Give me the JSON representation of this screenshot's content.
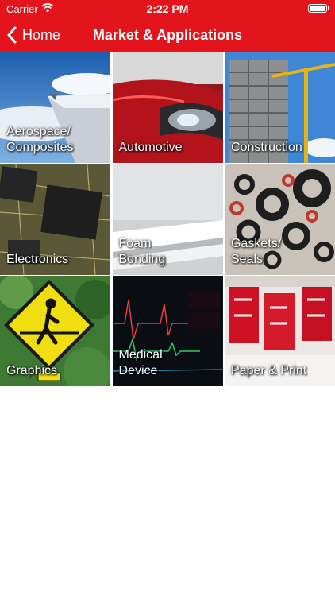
{
  "status_bar": {
    "carrier": "Carrier",
    "time": "2:22 PM",
    "icons": [
      "wifi-icon",
      "battery-icon"
    ]
  },
  "nav": {
    "back_label": "Home",
    "back_icon": "chevron-left-icon",
    "title": "Market & Applications"
  },
  "colors": {
    "brand_red": "#e3141b",
    "background": "#ffffff",
    "text_on_brand": "#ffffff"
  },
  "tiles": [
    {
      "label": "Aerospace/\nComposites",
      "image": "airplane-wing"
    },
    {
      "label": "Automotive",
      "image": "red-car-headlight"
    },
    {
      "label": "Construction",
      "image": "building-crane"
    },
    {
      "label": "Electronics",
      "image": "circuit-board"
    },
    {
      "label": "Foam\nBonding",
      "image": "foam-sheets"
    },
    {
      "label": "Gaskets/\nSeals",
      "image": "rubber-washers"
    },
    {
      "label": "Graphics",
      "image": "pedestrian-sign"
    },
    {
      "label": "Medical\nDevice",
      "image": "patient-monitor"
    },
    {
      "label": "Paper & Print",
      "image": "sale-banners"
    }
  ]
}
